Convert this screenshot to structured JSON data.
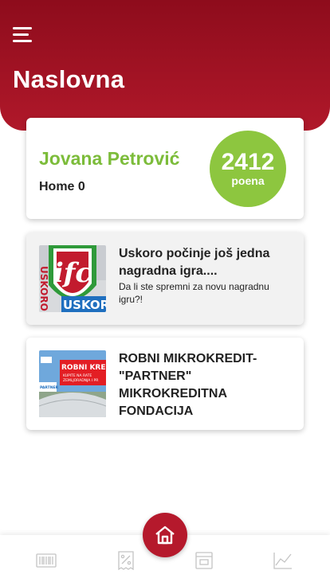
{
  "header": {
    "title": "Naslovna"
  },
  "profile": {
    "name": "Jovana Petrović",
    "subtitle": "Home 0",
    "points": "2412",
    "points_label": "poena"
  },
  "news": [
    {
      "title": "Uskoro počinje još jedna nagradna igra....",
      "description": "Da li ste spremni za novu nagradnu igru?!"
    },
    {
      "title": "ROBNI MIKROKREDIT- \"PARTNER\" MIKROKREDITNA FONDACIJA"
    }
  ],
  "thumbs": {
    "news1_text": "USKORO",
    "news2_lines": [
      "ROBNI KRED",
      "KUPITE NA RATE",
      "ZEMLJORADNJA I PR"
    ],
    "news2_badge": "PARTNER"
  },
  "tabs": [
    "barcode-icon",
    "discount-icon",
    "receipt-icon",
    "home-icon",
    "chart-icon"
  ],
  "colors": {
    "header_top": "#8e0c1c",
    "header_bottom": "#b0182a",
    "accent_green": "#8dc63f",
    "name_green": "#7cbc3a",
    "fab_red": "#b5192c"
  }
}
